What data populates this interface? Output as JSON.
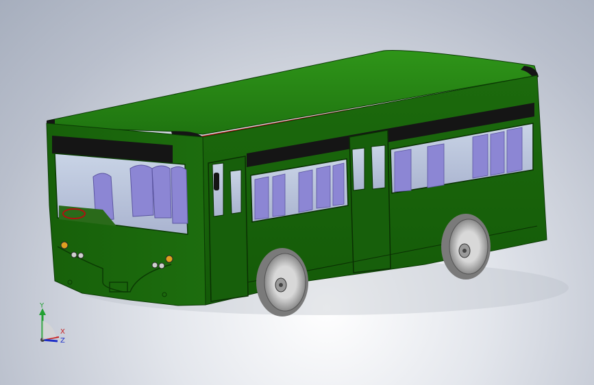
{
  "viewport": {
    "background_top": "#a6aebd",
    "background_center": "#ffffff",
    "model_name": "city-bus"
  },
  "model_colors": {
    "body_green": "#1e6e0e",
    "roof_green": "#2a8a16",
    "dark_green": "#104a06",
    "glass_tint": "#dfe7f2",
    "seat_purple": "#8c86d4",
    "tire": "#9a9a9a",
    "rim": "#cfcfcf",
    "red_stripe": "#b01010",
    "black_trim": "#151515"
  },
  "triad": {
    "y_label": "Y",
    "x_label": "X",
    "z_label": "Z",
    "y_color": "#22a033",
    "x_color": "#c81e1e",
    "z_color": "#1e2fc8"
  }
}
